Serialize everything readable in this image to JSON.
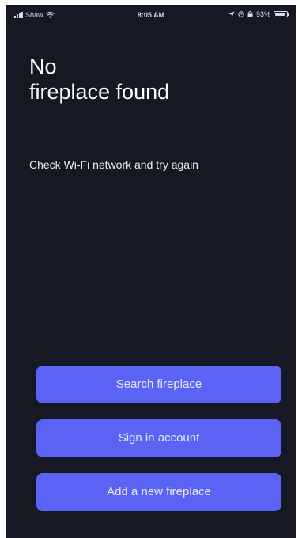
{
  "status_bar": {
    "carrier": "Shaw",
    "time": "8:05 AM",
    "battery": "93%",
    "icons": [
      "signal-icon",
      "wifi-icon",
      "location-icon",
      "alarm-icon",
      "lock-icon",
      "battery-icon"
    ]
  },
  "main": {
    "title_line1": "No",
    "title_line2": "fireplace found",
    "subtitle": "Check Wi-Fi network and try again"
  },
  "actions": {
    "search_label": "Search fireplace",
    "signin_label": "Sign in account",
    "add_label": "Add a new fireplace"
  },
  "colors": {
    "background": "#161923",
    "button": "#5b63f5",
    "text": "#ffffff"
  }
}
